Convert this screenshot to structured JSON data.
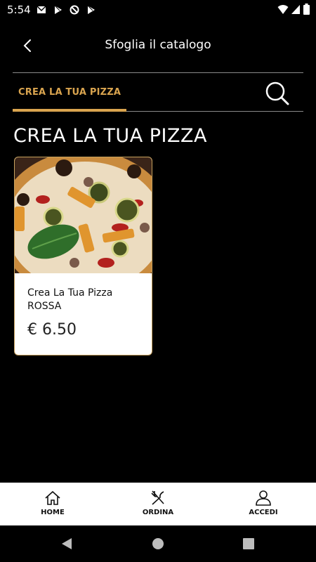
{
  "status_bar": {
    "time": "5:54"
  },
  "header": {
    "title": "Sfoglia il catalogo"
  },
  "tabs": [
    {
      "label": "CREA LA TUA PIZZA"
    }
  ],
  "section": {
    "title": "CREA LA TUA PIZZA"
  },
  "products": [
    {
      "name": "Crea La Tua Pizza ROSSA",
      "price": "€ 6.50"
    }
  ],
  "bottom_nav": [
    {
      "label": "HOME",
      "icon": "home-icon"
    },
    {
      "label": "ORDINA",
      "icon": "fork-knife-icon"
    },
    {
      "label": "ACCEDI",
      "icon": "user-icon"
    }
  ],
  "colors": {
    "accent": "#d9a44f",
    "background": "#000000",
    "card_border": "#c8a25e"
  }
}
